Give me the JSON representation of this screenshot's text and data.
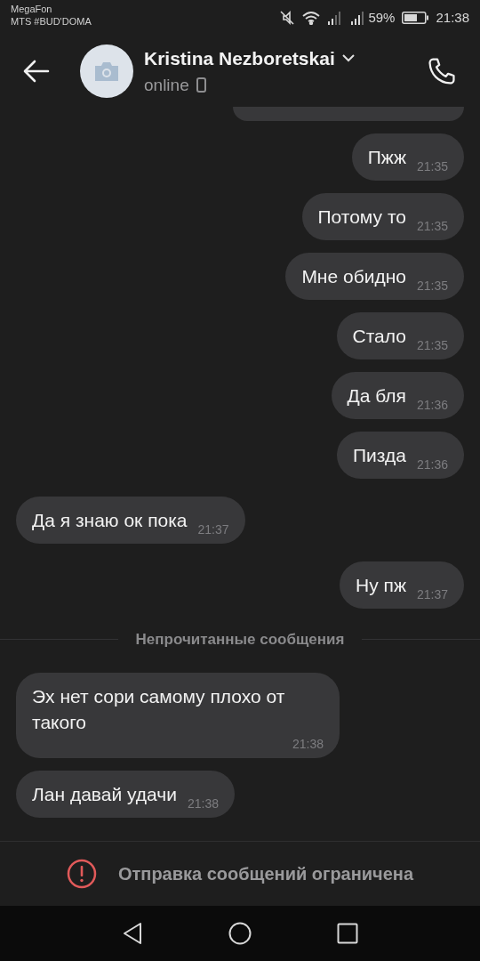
{
  "status_bar": {
    "carriers": [
      "MegaFon",
      "MTS #BUD'DOMA"
    ],
    "battery": "59%",
    "time": "21:38"
  },
  "header": {
    "name": "Kristina Nezboretskai",
    "status": "online"
  },
  "messages": [
    {
      "kind": "outgoing",
      "text": "Пжж",
      "time": "21:35"
    },
    {
      "kind": "outgoing",
      "text": "Потому то",
      "time": "21:35"
    },
    {
      "kind": "outgoing",
      "text": "Мне обидно",
      "time": "21:35"
    },
    {
      "kind": "outgoing",
      "text": "Стало",
      "time": "21:35"
    },
    {
      "kind": "outgoing",
      "text": "Да бля",
      "time": "21:36"
    },
    {
      "kind": "outgoing",
      "text": "Пизда",
      "time": "21:36"
    },
    {
      "kind": "incoming",
      "text": "Да я знаю ок пока",
      "time": "21:37"
    },
    {
      "kind": "outgoing",
      "text": "Ну пж",
      "time": "21:37"
    },
    {
      "kind": "divider",
      "text": "Непрочитанные сообщения"
    },
    {
      "kind": "incoming",
      "text": "Эх нет сори самому плохо от такого",
      "time": "21:38"
    },
    {
      "kind": "incoming",
      "text": "Лан давай удачи",
      "time": "21:38"
    }
  ],
  "restriction": {
    "text": "Отправка сообщений ограничена"
  }
}
